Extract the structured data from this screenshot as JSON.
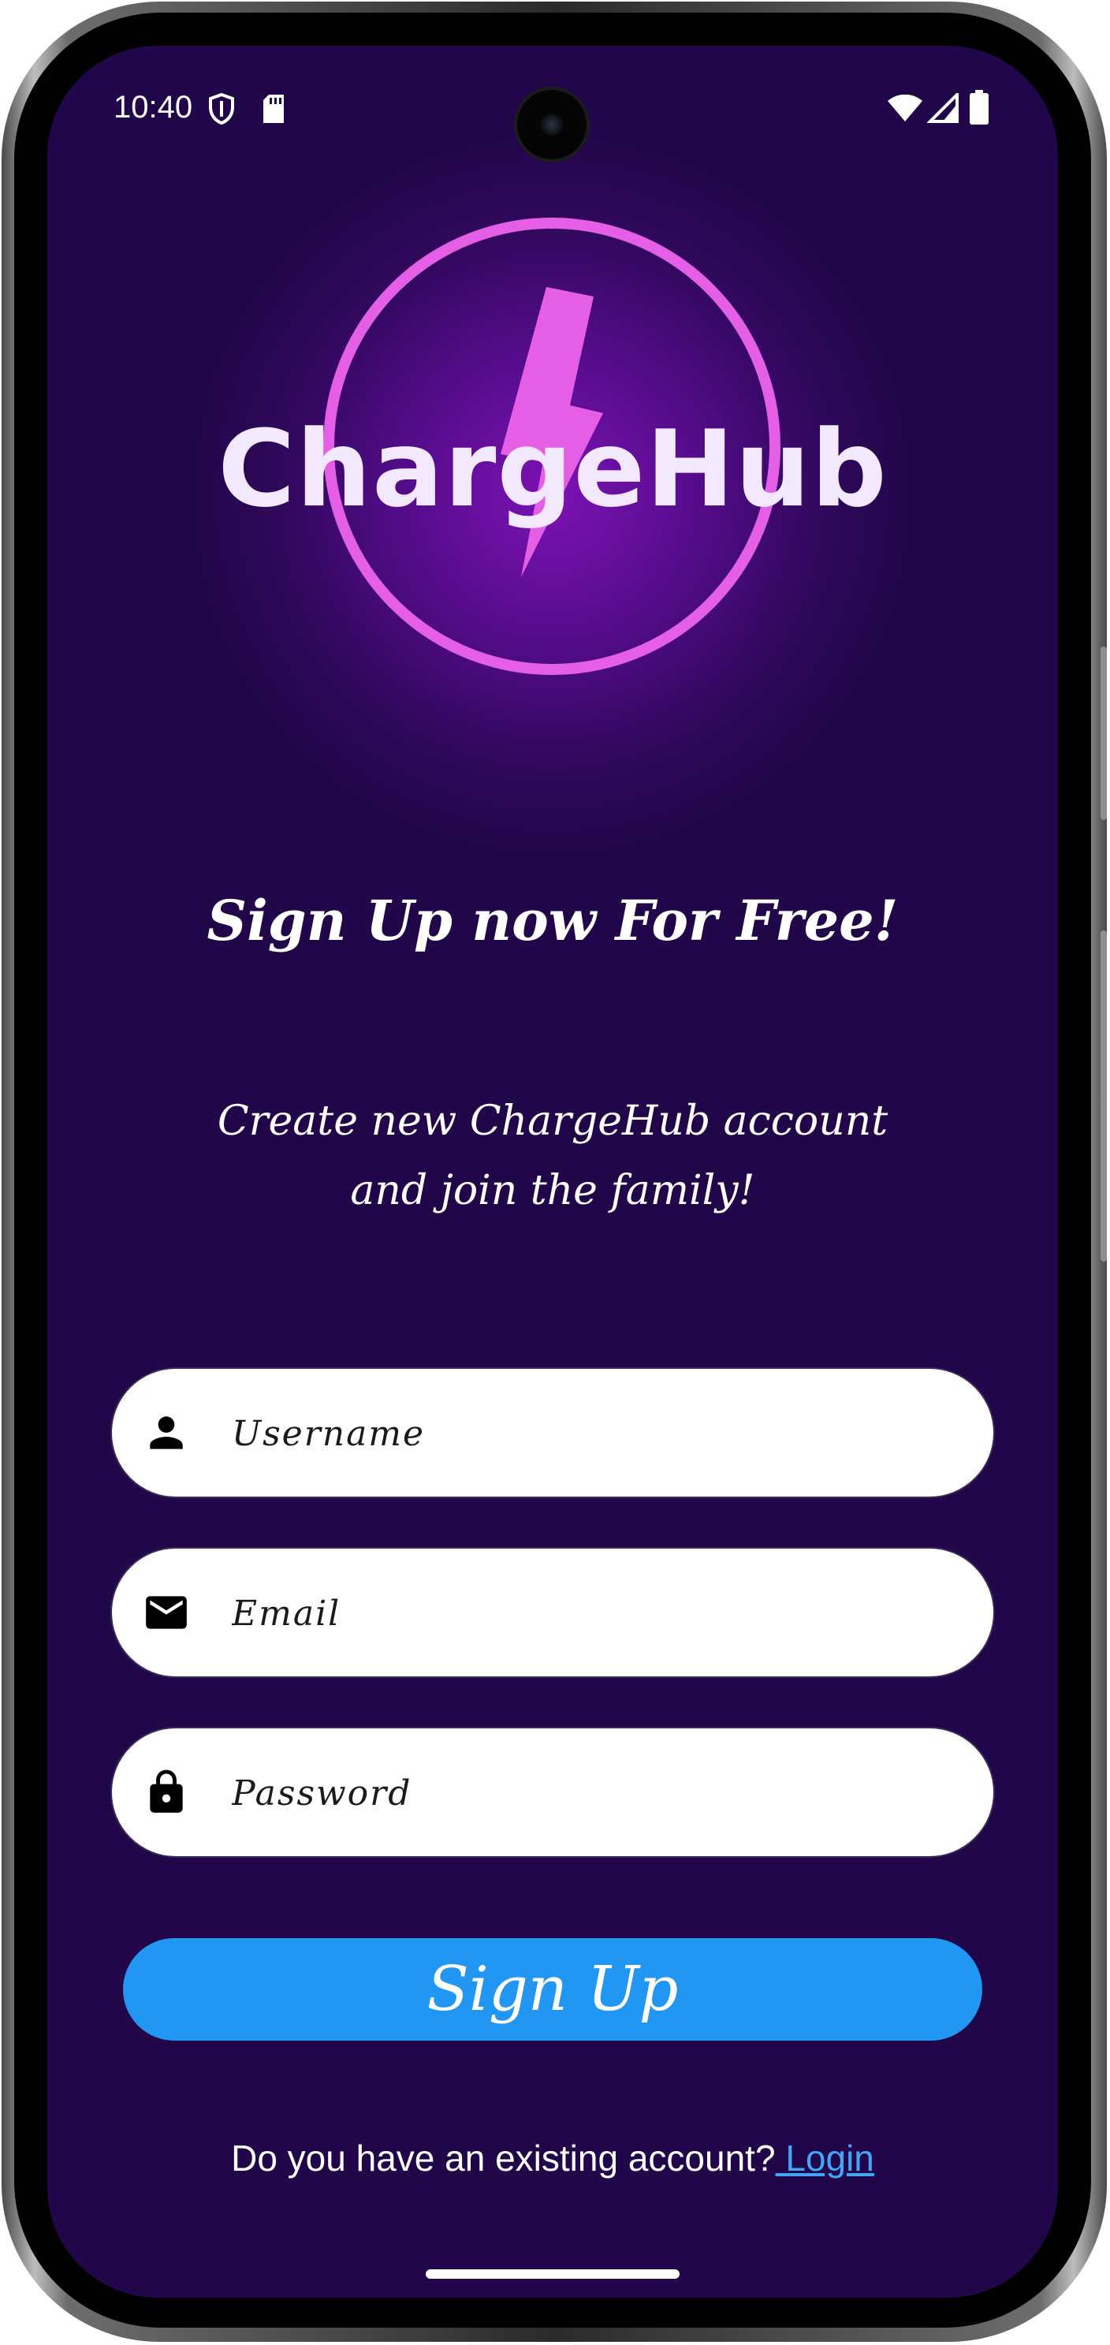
{
  "status_bar": {
    "time": "10:40",
    "left_icons": [
      "shield-icon",
      "sd-card-icon"
    ],
    "right_icons": [
      "wifi-icon",
      "signal-icon",
      "battery-icon"
    ]
  },
  "logo": {
    "text": "ChargeHub",
    "icon": "lightning-bolt-icon",
    "ring_color": "#e45fe6"
  },
  "headline": "Sign Up now For Free!",
  "subtitle": {
    "line1": "Create new ChargeHub account",
    "line2": "and join the family!"
  },
  "form": {
    "username": {
      "placeholder": "Username",
      "value": "",
      "icon": "person-icon"
    },
    "email": {
      "placeholder": "Email",
      "value": "",
      "icon": "mail-icon"
    },
    "password": {
      "placeholder": "Password",
      "value": "",
      "icon": "lock-icon"
    }
  },
  "signup_button": {
    "label": "Sign Up",
    "color": "#2196f3"
  },
  "footer": {
    "prompt": "Do you have an existing account?",
    "login_link": " Login"
  },
  "colors": {
    "background": "#22064a",
    "accent": "#2196f3",
    "link": "#42a5f5"
  }
}
